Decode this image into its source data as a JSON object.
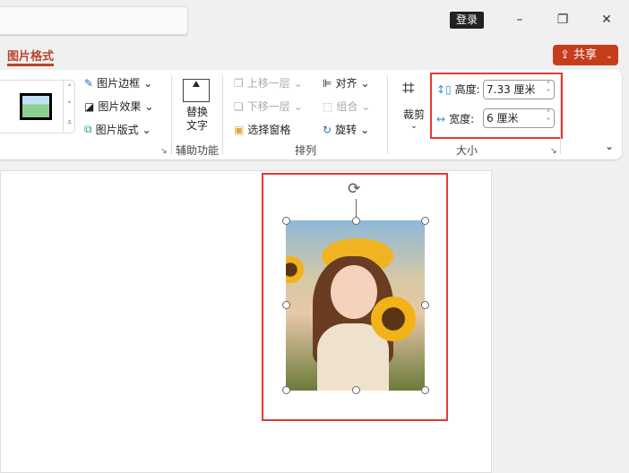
{
  "titlebar": {
    "login": "登录",
    "minimize": "–",
    "restore": "❐",
    "close": "✕"
  },
  "tabs": {
    "active": "图片格式"
  },
  "share": {
    "label": "共享"
  },
  "ribbon": {
    "picture_styles": {
      "border": "图片边框",
      "effects": "图片效果",
      "layout": "图片版式"
    },
    "accessibility": {
      "alt_text_line1": "替换",
      "alt_text_line2": "文字",
      "group": "辅助功能"
    },
    "arrange": {
      "bring_forward": "上移一层",
      "send_backward": "下移一层",
      "selection_pane": "选择窗格",
      "align": "对齐",
      "group_btn": "组合",
      "rotate": "旋转",
      "group": "排列"
    },
    "size": {
      "crop": "裁剪",
      "height_label": "高度:",
      "height_value": "7.33 厘米",
      "width_label": "宽度:",
      "width_value": "6 厘米",
      "group": "大小"
    }
  },
  "colors": {
    "accent": "#b7472a",
    "share": "#c43e1c",
    "highlight": "#e53935"
  }
}
